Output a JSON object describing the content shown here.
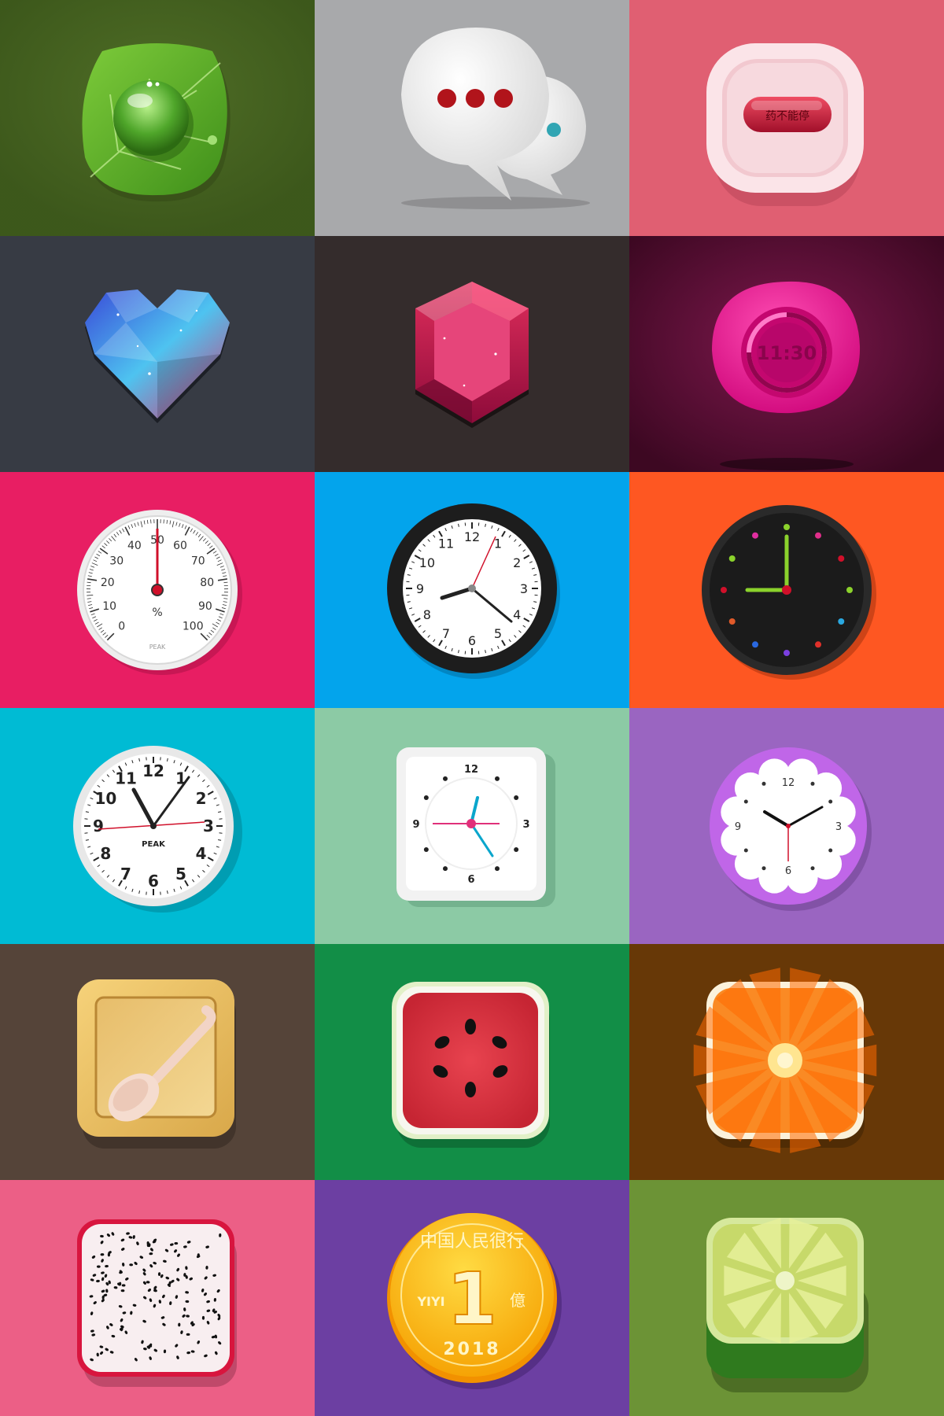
{
  "tiles": [
    {
      "id": "leaf",
      "icon": "leaf-water-drop-icon",
      "bg": "#3f5b1d"
    },
    {
      "id": "chat",
      "icon": "chat-bubbles-icon",
      "bg": "#a8a9ab"
    },
    {
      "id": "pill",
      "icon": "pill-button-icon",
      "bg": "#e05f72",
      "pill_text": "药不能停"
    },
    {
      "id": "heart",
      "icon": "crystal-heart-icon",
      "bg": "#373b44"
    },
    {
      "id": "gem",
      "icon": "ruby-gem-icon",
      "bg": "#342c2c"
    },
    {
      "id": "timer",
      "icon": "pink-timer-icon",
      "bg": "#4a0c2c",
      "time": "11:30"
    },
    {
      "id": "hygrometer",
      "icon": "hygrometer-gauge-icon",
      "bg": "#e81e63",
      "ticks": [
        "0",
        "10",
        "20",
        "30",
        "40",
        "50",
        "60",
        "70",
        "80",
        "90",
        "100"
      ],
      "unit": "%",
      "brand": "PEAK"
    },
    {
      "id": "wallclock",
      "icon": "black-wall-clock-icon",
      "bg": "#03a4ec",
      "numerals": [
        "12",
        "1",
        "2",
        "3",
        "4",
        "5",
        "6",
        "7",
        "8",
        "9",
        "10",
        "11"
      ]
    },
    {
      "id": "darkclock",
      "icon": "dark-dot-clock-icon",
      "bg": "#fe5722"
    },
    {
      "id": "peakclock",
      "icon": "peak-clock-icon",
      "bg": "#00bbd4",
      "numerals": [
        "12",
        "1",
        "2",
        "3",
        "4",
        "5",
        "6",
        "7",
        "8",
        "9",
        "10",
        "11"
      ],
      "brand": "PEAK"
    },
    {
      "id": "squareclock",
      "icon": "square-clock-icon",
      "bg": "#8ccaa5",
      "numerals": {
        "n12": "12",
        "n3": "3",
        "n6": "6",
        "n9": "9"
      }
    },
    {
      "id": "flowerclock",
      "icon": "flower-clock-icon",
      "bg": "#9a65c1",
      "numerals": {
        "n12": "12",
        "n3": "3",
        "n6": "6",
        "n9": "9"
      }
    },
    {
      "id": "spoon",
      "icon": "wooden-spoon-icon",
      "bg": "#554439"
    },
    {
      "id": "watermelon",
      "icon": "watermelon-icon",
      "bg": "#128e47"
    },
    {
      "id": "orange",
      "icon": "orange-slice-icon",
      "bg": "#673807"
    },
    {
      "id": "dragonfruit",
      "icon": "dragon-fruit-icon",
      "bg": "#ec5f86"
    },
    {
      "id": "coin",
      "icon": "gold-coin-icon",
      "bg": "#6c3fa2",
      "top_text": "中国人民很行",
      "value": "1",
      "left_text": "YIYI",
      "right_text": "億",
      "year": "2018"
    },
    {
      "id": "lime",
      "icon": "lime-slice-icon",
      "bg": "#6c9336"
    }
  ]
}
